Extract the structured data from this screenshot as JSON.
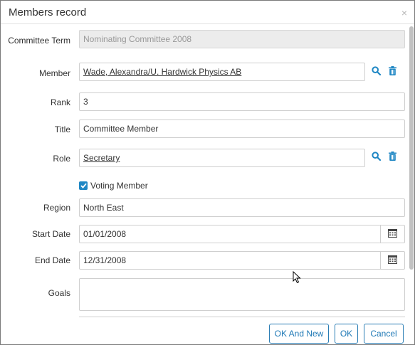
{
  "dialog": {
    "title": "Members record",
    "close_glyph": "×"
  },
  "form": {
    "committee_term": {
      "label": "Committee Term",
      "value": "Nominating Committee 2008"
    },
    "member": {
      "label": "Member",
      "value": "Wade, Alexandra/U. Hardwick Physics AB"
    },
    "rank": {
      "label": "Rank",
      "value": "3"
    },
    "title": {
      "label": "Title",
      "value": "Committee Member"
    },
    "role": {
      "label": "Role",
      "value": "Secretary"
    },
    "voting_member": {
      "label": "Voting Member",
      "checked": true
    },
    "region": {
      "label": "Region",
      "value": "North East"
    },
    "start_date": {
      "label": "Start Date",
      "value": "01/01/2008"
    },
    "end_date": {
      "label": "End Date",
      "value": "12/31/2008"
    },
    "goals": {
      "label": "Goals",
      "value": ""
    }
  },
  "footer": {
    "ok_and_new": "OK And New",
    "ok": "OK",
    "cancel": "Cancel"
  },
  "icons": {
    "search": "search-icon",
    "delete": "trash-icon",
    "calendar": "calendar-icon",
    "accent_color": "#1f87c4"
  }
}
